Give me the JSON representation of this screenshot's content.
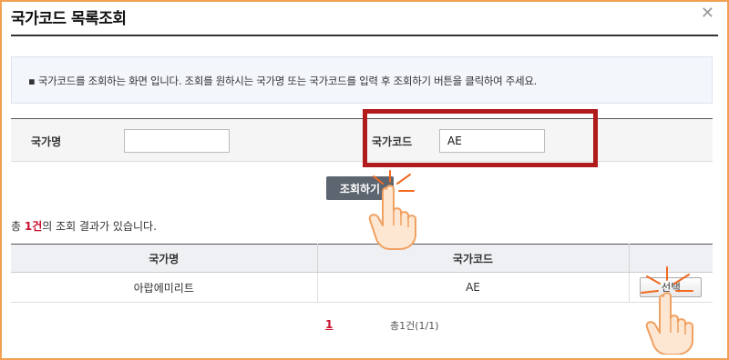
{
  "dialog": {
    "title": "국가코드 목록조회",
    "close_glyph": "✕"
  },
  "info": {
    "text": "▪ 국가코드를 조회하는 화면 입니다. 조회를 원하시는 국가명 또는 국가코드를 입력 후 조회하기 버튼을 클릭하여 주세요."
  },
  "search": {
    "country_name_label": "국가명",
    "country_name_value": "",
    "country_code_label": "국가코드",
    "country_code_value": "AE",
    "button_label": "조회하기"
  },
  "result": {
    "prefix": "총 ",
    "count": "1건",
    "suffix": "의 조회 결과가 있습니다."
  },
  "table": {
    "headers": [
      "국가명",
      "국가코드",
      ""
    ],
    "rows": [
      {
        "name": "아랍에미리트",
        "code": "AE",
        "select_label": "선택"
      }
    ]
  },
  "pagination": {
    "current_page": "1",
    "summary": "총1건(1/1)"
  },
  "colors": {
    "highlight": "#b01b1b",
    "accent": "#c8102e",
    "frame": "#f0a050"
  },
  "annotations": {
    "hand_pointer_icon": "hand-pointer-icon"
  }
}
